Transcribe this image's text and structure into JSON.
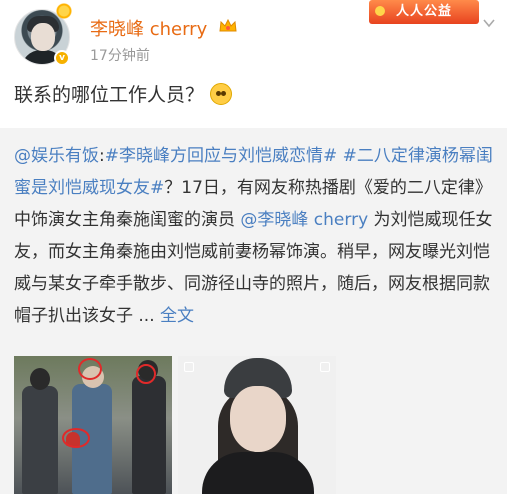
{
  "post": {
    "username": "李晓峰 cherry",
    "time": "17分钟前",
    "text": "联系的哪位工作人员？",
    "badge": "人人公益"
  },
  "repost": {
    "mention_user": "@娱乐有饭",
    "colon": ":",
    "topic1": "#李晓峰方回应与刘恺威恋情#",
    "topic2": "#二八定律演杨幂闺蜜是刘恺威现女友#",
    "body1": "？17日，有网友称热播剧《爱的二八定律》中饰演女主角秦施闺蜜的演员",
    "mention2": "@李晓峰 cherry",
    "body2": "为刘恺威现任女友，而女主角秦施由刘恺威前妻杨幂饰演。稍早，网友曝光刘恺威与某女子牵手散步、同游径山寺的照片，随后，网友根据同款帽子扒出该女子 ...",
    "more": "全文"
  },
  "icons": {
    "avatar": "avatar",
    "sun": "sun-icon",
    "verify": "verified-badge-icon",
    "crown": "crown-icon",
    "chevron": "chevron-down-icon",
    "emoji": "thinking-emoji-icon"
  },
  "colors": {
    "username": "#e86b14",
    "link": "#4a7fc1",
    "repost_bg": "#f3f3f3",
    "badge": "#e8431f"
  }
}
